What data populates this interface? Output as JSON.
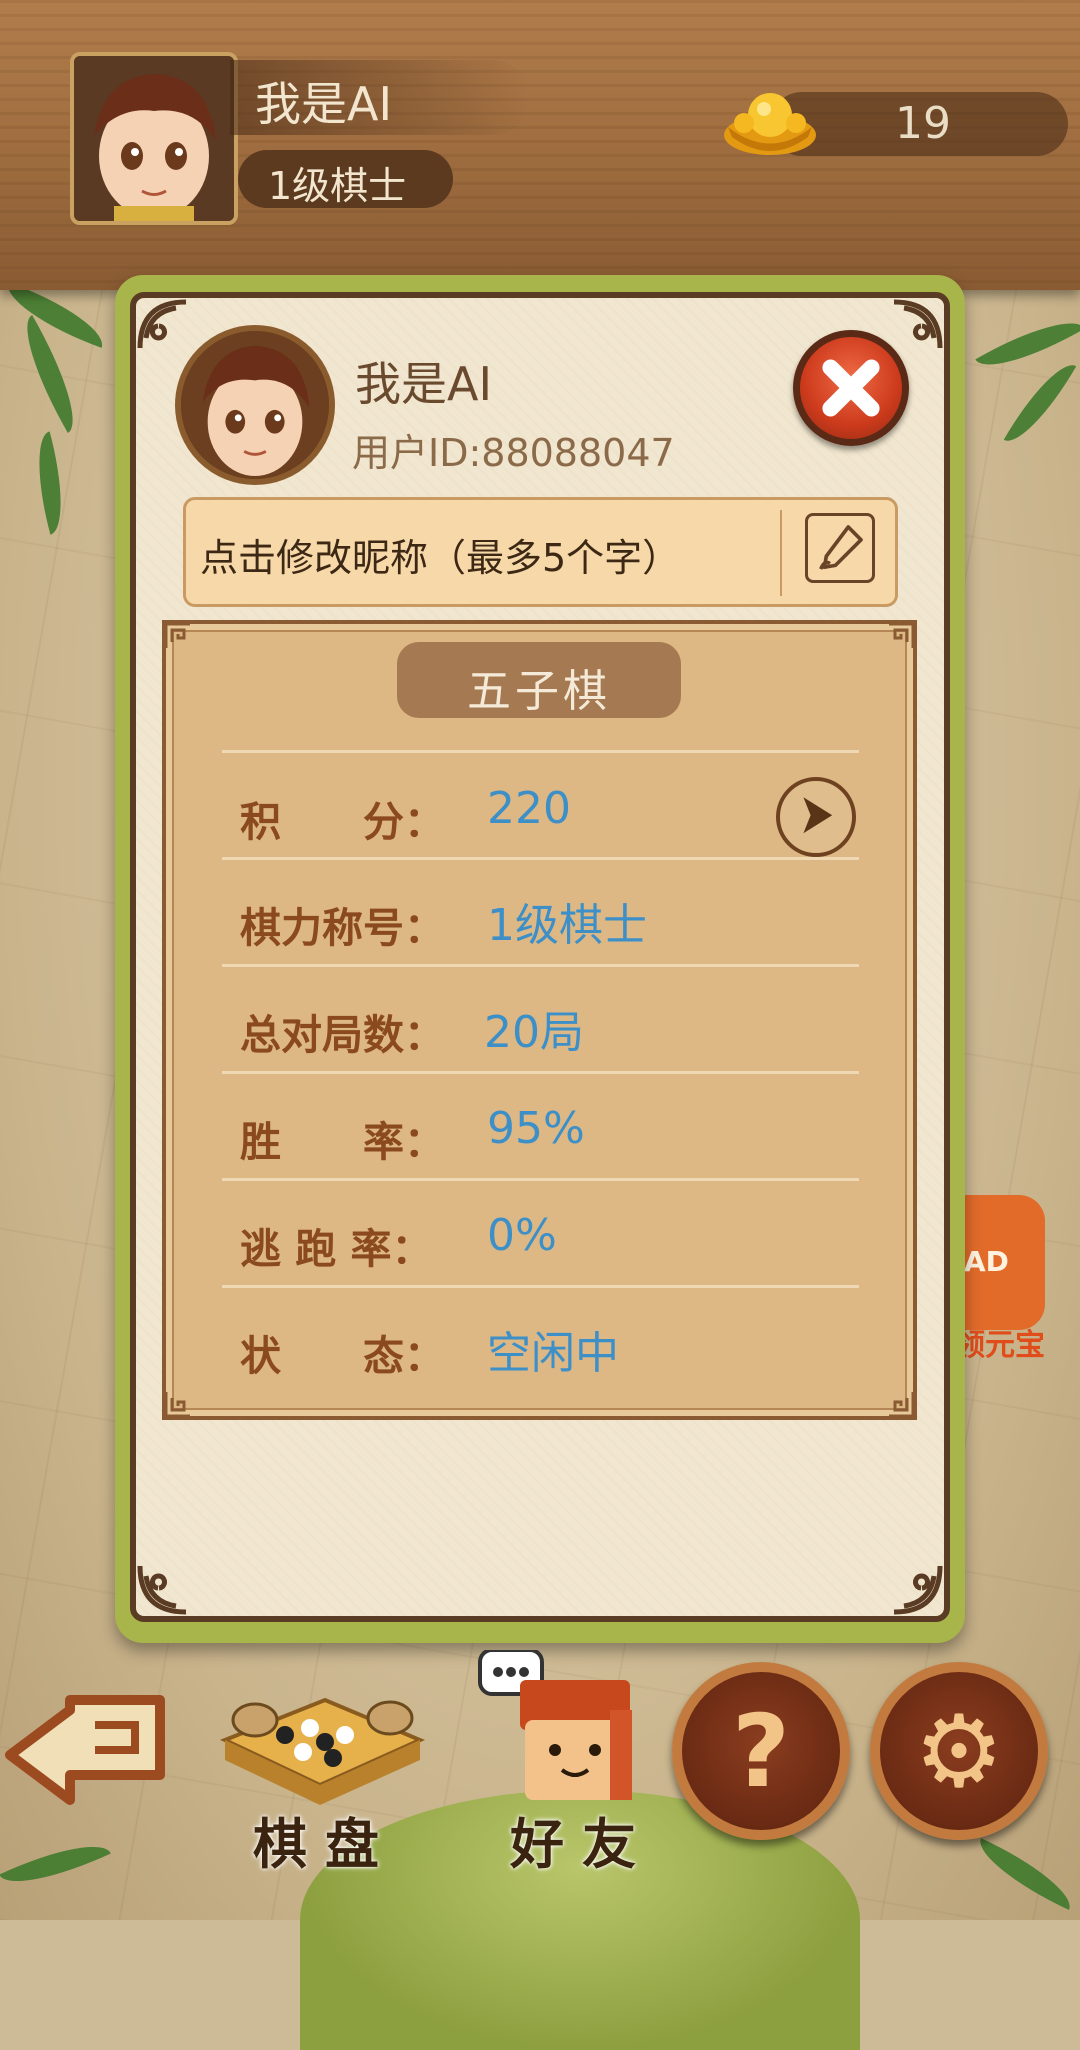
{
  "top_bar": {
    "player_name": "我是AI",
    "level": "1级棋士",
    "ingot_count": "19"
  },
  "profile_dialog": {
    "name": "我是AI",
    "user_id": "用户ID:88088047",
    "nickname_prompt": "点击修改昵称（最多5个字）",
    "game_tab": "五子棋",
    "stats": [
      {
        "label": "积　　分：",
        "value": "220"
      },
      {
        "label": "棋力称号：",
        "value": "1级棋士"
      },
      {
        "label": "总对局数：",
        "value": "20局"
      },
      {
        "label": "胜　　率：",
        "value": "95%"
      },
      {
        "label": "逃 跑 率：",
        "value": "0%"
      },
      {
        "label": "状　　态：",
        "value": "空闲中"
      }
    ]
  },
  "side_ad": {
    "badge": "AD",
    "text": "领元宝"
  },
  "bottom_nav": {
    "board_label": "棋盘",
    "friends_label": "好友",
    "help_glyph": "?",
    "settings_glyph": "⚙"
  },
  "colors": {
    "value_blue": "#3d8fc8",
    "label_brown": "#8a4a1e",
    "dialog_border_green": "#a8b54b"
  }
}
